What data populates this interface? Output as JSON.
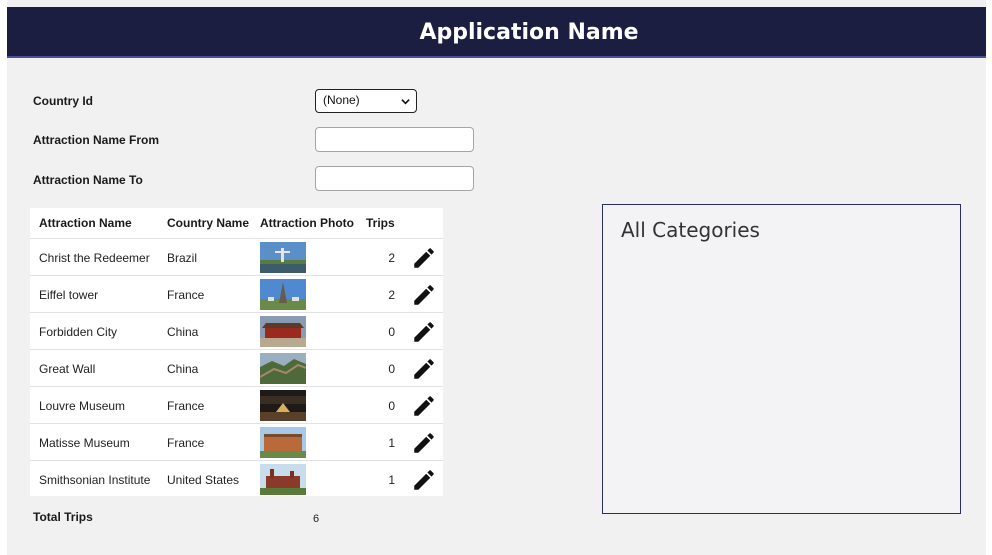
{
  "app": {
    "title": "Application Name"
  },
  "filters": {
    "country_id_label": "Country Id",
    "country_id_value": "(None)",
    "name_from_label": "Attraction Name From",
    "name_from_value": "",
    "name_to_label": "Attraction Name To",
    "name_to_value": ""
  },
  "grid": {
    "columns": [
      "Attraction Name",
      "Country Name",
      "Attraction Photo",
      "Trips"
    ],
    "rows": [
      {
        "name": "Christ the Redeemer",
        "country": "Brazil",
        "trips": "2",
        "photo": "christ-the-redeemer-photo"
      },
      {
        "name": "Eiffel tower",
        "country": "France",
        "trips": "2",
        "photo": "eiffel-tower-photo"
      },
      {
        "name": "Forbidden City",
        "country": "China",
        "trips": "0",
        "photo": "forbidden-city-photo"
      },
      {
        "name": "Great Wall",
        "country": "China",
        "trips": "0",
        "photo": "great-wall-photo"
      },
      {
        "name": "Louvre Museum",
        "country": "France",
        "trips": "0",
        "photo": "louvre-museum-photo"
      },
      {
        "name": "Matisse Museum",
        "country": "France",
        "trips": "1",
        "photo": "matisse-museum-photo"
      },
      {
        "name": "Smithsonian Institute",
        "country": "United States",
        "trips": "1",
        "photo": "smithsonian-institute-photo"
      }
    ],
    "edit_icon": "pencil-icon"
  },
  "totals": {
    "label": "Total Trips",
    "value": "6"
  },
  "categories": {
    "title": "All Categories"
  },
  "colors": {
    "header_bg": "#1b1d41",
    "page_bg": "#f1f1f2",
    "panel_border": "#2a2e66"
  }
}
